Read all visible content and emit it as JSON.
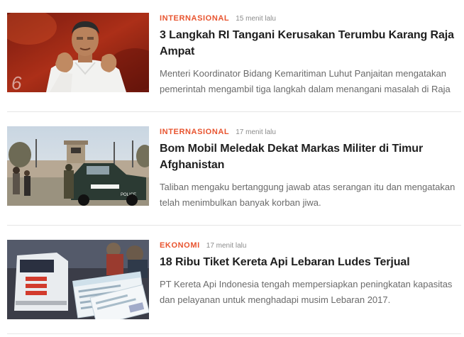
{
  "colors": {
    "category": "#e8542f",
    "headline": "#1f1f1f",
    "summary": "#6a6a6a",
    "time": "#8c8c8c",
    "divider": "#e6e6e6"
  },
  "articles": [
    {
      "category": "INTERNASIONAL",
      "time": "15 menit lalu",
      "headline": "3 Langkah RI Tangani Kerusakan Terumbu Karang Raja Ampat",
      "summary": "Menteri Koordinator Bidang Kemaritiman Luhut Panjaitan mengatakan pemerintah mengambil tiga langkah dalam menangani masalah di Raja",
      "thumbnail": "photo-man-speaking",
      "watermark": "6"
    },
    {
      "category": "INTERNASIONAL",
      "time": "17 menit lalu",
      "headline": "Bom Mobil Meledak Dekat Markas Militer di Timur Afghanistan",
      "summary": "Taliban mengaku bertanggung jawab atas serangan itu dan mengatakan telah menimbulkan banyak korban jiwa.",
      "thumbnail": "photo-police-checkpoint",
      "vehicle_text": "POLICE"
    },
    {
      "category": "EKONOMI",
      "time": "17 menit lalu",
      "headline": "18 Ribu Tiket Kereta Api Lebaran Ludes Terjual",
      "summary": "PT Kereta Api Indonesia tengah mempersiapkan peningkatan kapasitas dan pelayanan untuk menghadapi musim Lebaran 2017.",
      "thumbnail": "photo-train-tickets"
    }
  ]
}
